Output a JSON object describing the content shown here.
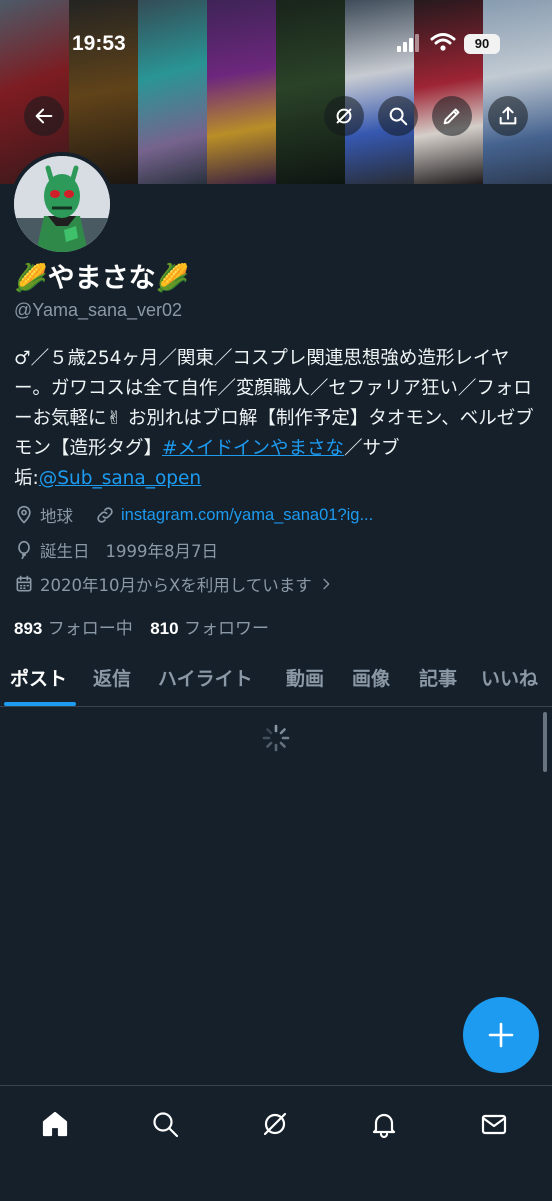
{
  "status": {
    "time": "19:53",
    "battery": "90"
  },
  "profile": {
    "name": "🌽やまさな🌽",
    "handle": "@Yama_sana_ver02",
    "bio_text": "♂／５歳254ヶ月／関東／コスプレ関連思想強め造形レイヤー。ガワコスは全て自作／変顔職人／セファリア狂い／フォローお気軽に✌ お別れはブロ解【制作予定】タオモン、ベルゼブモン【造形タグ】",
    "bio_hashtag": "#メイドインやまさな",
    "bio_sub_text": "／サブ垢:",
    "bio_mention": "@Sub_sana_open",
    "location": "地球",
    "website": "instagram.com/yama_sana01?ig...",
    "birthday_label": "誕生日",
    "birthday": "1999年8月7日",
    "joined": "2020年10月からXを利用しています",
    "following_count": "893",
    "following_label": "フォロー中",
    "followers_count": "810",
    "followers_label": "フォロワー"
  },
  "tabs": [
    "ポスト",
    "返信",
    "ハイライト",
    "動画",
    "画像",
    "記事",
    "いいね"
  ],
  "colors": {
    "background": "#15202b",
    "accent": "#1d9bf0",
    "muted": "#8b98a5",
    "divider": "#38444d"
  },
  "icons": {
    "header": [
      "back-arrow-icon",
      "grok-icon",
      "search-icon",
      "edit-icon",
      "share-icon"
    ],
    "nav": [
      "home-icon",
      "search-icon",
      "grok-icon",
      "bell-icon",
      "mail-icon"
    ],
    "fab": "plus-icon"
  }
}
